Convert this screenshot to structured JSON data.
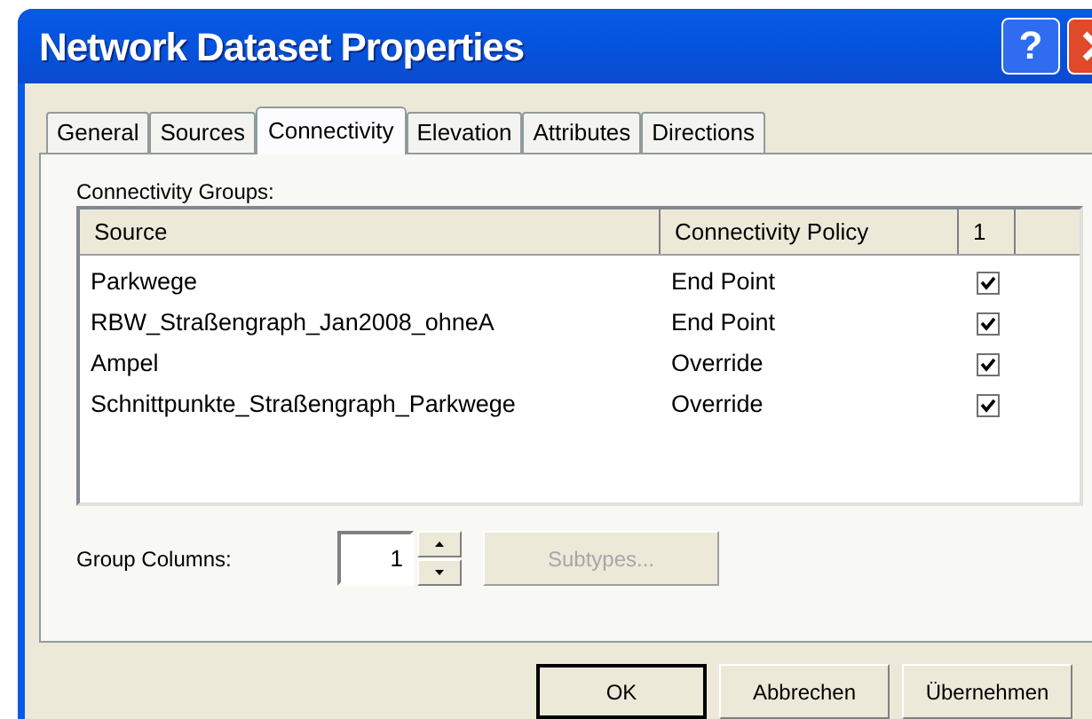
{
  "window": {
    "title": "Network Dataset Properties",
    "help": "?"
  },
  "tabs": [
    {
      "label": "General",
      "selected": false
    },
    {
      "label": "Sources",
      "selected": false
    },
    {
      "label": "Connectivity",
      "selected": true
    },
    {
      "label": "Elevation",
      "selected": false
    },
    {
      "label": "Attributes",
      "selected": false
    },
    {
      "label": "Directions",
      "selected": false
    }
  ],
  "groups_label": "Connectivity Groups:",
  "table": {
    "columns": [
      "Source",
      "Connectivity Policy",
      "1"
    ],
    "rows": [
      {
        "source": "Parkwege",
        "policy": "End Point",
        "checked": true
      },
      {
        "source": "RBW_Straßengraph_Jan2008_ohneA",
        "policy": "End Point",
        "checked": true
      },
      {
        "source": "Ampel",
        "policy": "Override",
        "checked": true
      },
      {
        "source": "Schnittpunkte_Straßengraph_Parkwege",
        "policy": "Override",
        "checked": true
      }
    ]
  },
  "group_columns": {
    "label": "Group Columns:",
    "value": "1"
  },
  "subtypes_button": {
    "label": "Subtypes...",
    "disabled": true
  },
  "buttons": [
    {
      "label": "OK",
      "default": true
    },
    {
      "label": "Abbrechen",
      "default": false
    },
    {
      "label": "Übernehmen",
      "default": false
    }
  ]
}
